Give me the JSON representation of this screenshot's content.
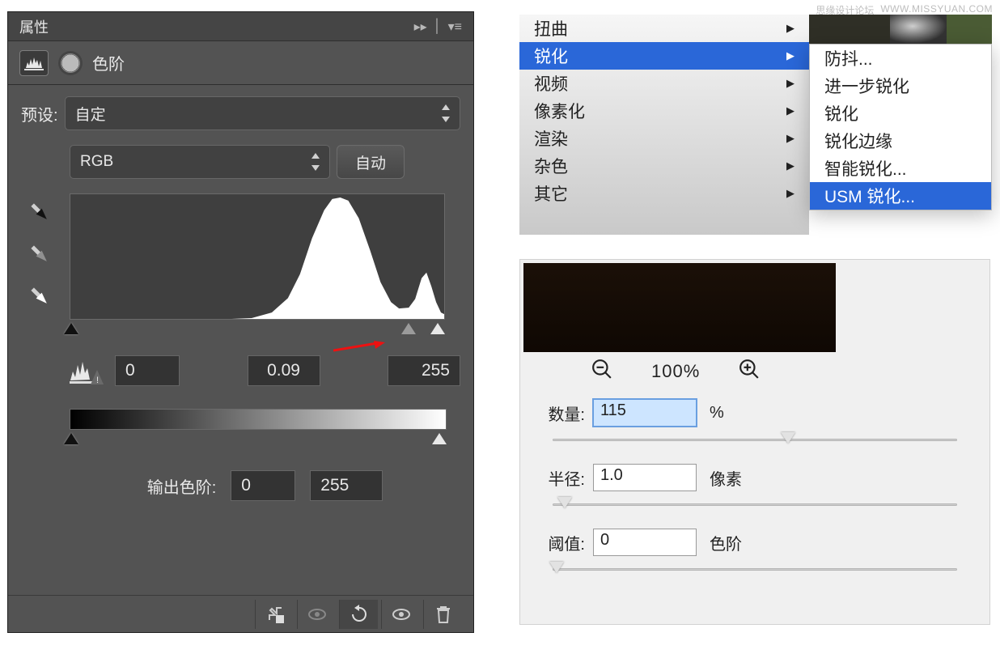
{
  "watermark": {
    "left": "思缘设计论坛",
    "right": "WWW.MISSYUAN.COM"
  },
  "levels": {
    "title": "属性",
    "subtitle": "色阶",
    "preset_label": "预设:",
    "preset_value": "自定",
    "channel_value": "RGB",
    "auto_label": "自动",
    "inputs": {
      "black": "0",
      "gamma": "0.09",
      "white": "255"
    },
    "output_label": "输出色阶:",
    "outputs": {
      "black": "0",
      "white": "255"
    },
    "icons": {
      "snap": "snap-icon",
      "visibility": "visibility-icon",
      "reset": "reset-icon",
      "trash": "trash-icon",
      "visibility2": "visibility-icon"
    }
  },
  "filter_menu": {
    "items": [
      {
        "label": "扭曲",
        "selected": false
      },
      {
        "label": "锐化",
        "selected": true
      },
      {
        "label": "视频",
        "selected": false
      },
      {
        "label": "像素化",
        "selected": false
      },
      {
        "label": "渲染",
        "selected": false
      },
      {
        "label": "杂色",
        "selected": false
      },
      {
        "label": "其它",
        "selected": false
      }
    ],
    "sub_items": [
      {
        "label": "防抖...",
        "selected": false
      },
      {
        "label": "进一步锐化",
        "selected": false
      },
      {
        "label": "锐化",
        "selected": false
      },
      {
        "label": "锐化边缘",
        "selected": false
      },
      {
        "label": "智能锐化...",
        "selected": false
      },
      {
        "label": "USM 锐化...",
        "selected": true
      }
    ]
  },
  "usm": {
    "zoom": "100%",
    "amount_label": "数量:",
    "amount_value": "115",
    "amount_unit": "%",
    "radius_label": "半径:",
    "radius_value": "1.0",
    "radius_unit": "像素",
    "threshold_label": "阈值:",
    "threshold_value": "0",
    "threshold_unit": "色阶"
  }
}
